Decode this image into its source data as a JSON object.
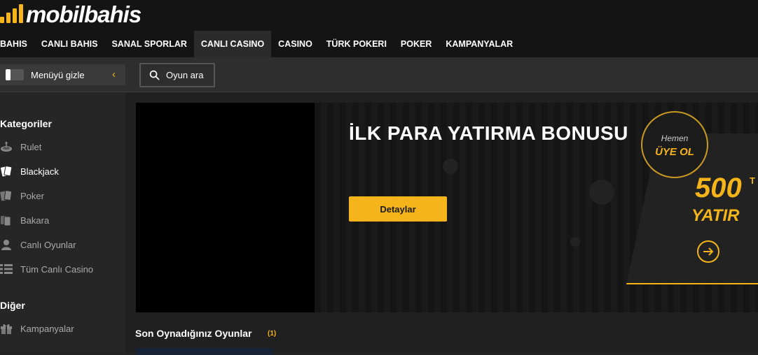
{
  "brand": {
    "logo_text_a": "mobil",
    "logo_text_b": "bahis",
    "accent_color": "#f4b41a"
  },
  "nav": {
    "items": [
      {
        "label": "BAHIS"
      },
      {
        "label": "CANLI BAHIS"
      },
      {
        "label": "SANAL SPORLAR"
      },
      {
        "label": "CANLI CASINO",
        "active": true
      },
      {
        "label": "CASINO"
      },
      {
        "label": "TÜRK POKERI"
      },
      {
        "label": "POKER"
      },
      {
        "label": "KAMPANYALAR"
      }
    ]
  },
  "subbar": {
    "menu_toggle_label": "Menüyü gizle",
    "search_label": "Oyun ara"
  },
  "sidebar": {
    "categories_title": "Kategoriler",
    "categories": [
      {
        "label": "Rulet",
        "icon": "roulette-icon"
      },
      {
        "label": "Blackjack",
        "icon": "cards-icon",
        "active": true
      },
      {
        "label": "Poker",
        "icon": "poker-cards-icon"
      },
      {
        "label": "Bakara",
        "icon": "baccarat-cards-icon"
      },
      {
        "label": "Canlı Oyunlar",
        "icon": "dealer-icon"
      },
      {
        "label": "Tüm Canlı Casino",
        "icon": "list-icon"
      }
    ],
    "other_title": "Diğer",
    "other": [
      {
        "label": "Kampanyalar",
        "icon": "gift-icon"
      }
    ]
  },
  "banner": {
    "title": "İLK PARA YATIRMA BONUSU",
    "button_label": "Detaylar",
    "hemen_top": "Hemen",
    "hemen_bottom": "ÜYE OL",
    "amount": "500",
    "amount_unit": "T",
    "deposit_label": "YATIR"
  },
  "recent": {
    "title": "Son Oynadığınız Oyunlar",
    "count": "(1)"
  }
}
